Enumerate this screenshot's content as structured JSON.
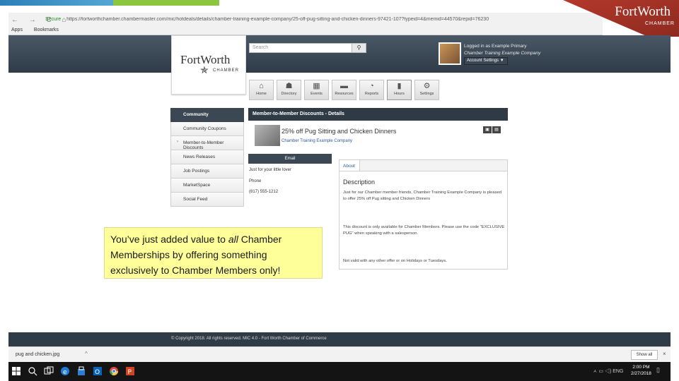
{
  "browser": {
    "nav_icons": "← → C ⌂",
    "secure_label": "Secure",
    "url": "https://fortworthchamber.chambermaster.com/mic/hotdeals/details/chamber-training-example-company/25-off-pug-sitting-and-chicken-dinners-97421-107?typeid=4&memid=44570&repid=76230",
    "bookmarks": [
      "Apps",
      "Bookmarks"
    ]
  },
  "brand": {
    "name": "FortWorth",
    "sub": "CHAMBER"
  },
  "site": {
    "logo_name": "FortWorth",
    "logo_sub": "CHAMBER",
    "search_placeholder": "Search",
    "search_icon": "magnifier",
    "user_line1": "Logged in as Example Primary",
    "user_line2": "Chamber Training Example Company",
    "account_button": "Account Settings ▼"
  },
  "tiles": [
    {
      "label": "Home",
      "icon": "⌂"
    },
    {
      "label": "Directory",
      "icon": "☗"
    },
    {
      "label": "Events",
      "icon": "▦"
    },
    {
      "label": "Resources",
      "icon": "▬"
    },
    {
      "label": "Reports",
      "icon": "◔"
    },
    {
      "label": "Hours",
      "icon": "▮"
    },
    {
      "label": "Settings",
      "icon": "⚙"
    }
  ],
  "leftnav": {
    "header": "Community",
    "items": [
      "Community Coupons",
      "Member-to-Member Discounts",
      "News Releases",
      "Job Postings",
      "MarketSpace",
      "Social Feed"
    ]
  },
  "content": {
    "header": "Member-to-Member Discounts - Details",
    "deal_title": "25% off Pug Sitting and Chicken Dinners",
    "deal_company": "Chamber Training Example Company",
    "email_button": "Email",
    "tagline": "Just for your little lover",
    "phone_label": "Phone",
    "phone": "(817) 555-1212",
    "about_tab": "About",
    "desc_title": "Description",
    "desc_p1": "Just for our Chamber member friends, Chamber Training Example Company is pleased to offer 25% off Pug sitting and Chicken Dinners",
    "desc_p2": "This discount is only available for Chamber Members. Please use the code \"EXCLUSIVE PUG\" when speaking with a salesperson.",
    "desc_p3": "Not valid with any other offer or on Holidays or Tuesdays."
  },
  "callout": {
    "part1": "You’ve just added value to ",
    "emph": "all",
    "part2": " Chamber Memberships by offering something exclusively to Chamber Members only!"
  },
  "footer": {
    "text": "© Copyright 2018. All rights reserved. MIC 4.0 - Fort Worth Chamber of Commerce"
  },
  "download": {
    "file": "pug and chicken.jpg",
    "show_all": "Show all",
    "close": "×"
  },
  "taskbar": {
    "icons": [
      "windows",
      "search",
      "task-view",
      "edge",
      "store",
      "outlook",
      "chrome",
      "powerpoint"
    ],
    "tray": "ㅅ ▭ ◁) ENG",
    "time": "2:00 PM",
    "date": "2/27/2018"
  }
}
